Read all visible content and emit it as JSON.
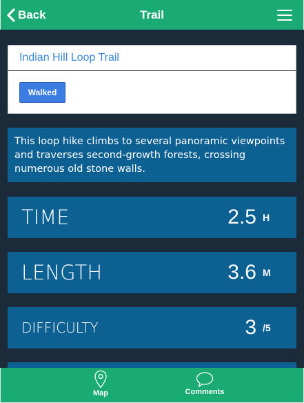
{
  "header": {
    "back_label": "Back",
    "title": "Trail"
  },
  "trail": {
    "name": "Indian Hill Loop Trail",
    "walked_label": "Walked",
    "description": "This loop hike climbs to several panoramic viewpoints and traverses second-growth forests, crossing numerous old stone walls."
  },
  "stats": {
    "time": {
      "label": "TIME",
      "value": "2.5",
      "unit": "H"
    },
    "length": {
      "label": "LENGTH",
      "value": "3.6",
      "unit": "M"
    },
    "difficulty": {
      "label": "DIFFICULTY",
      "value": "3",
      "unit": "/5"
    }
  },
  "nav": {
    "map_label": "Map",
    "comments_label": "Comments"
  },
  "colors": {
    "brand_green": "#1aab74",
    "panel_blue": "#0d6192",
    "background": "#1c2b3a",
    "button_blue": "#3b7de3"
  }
}
